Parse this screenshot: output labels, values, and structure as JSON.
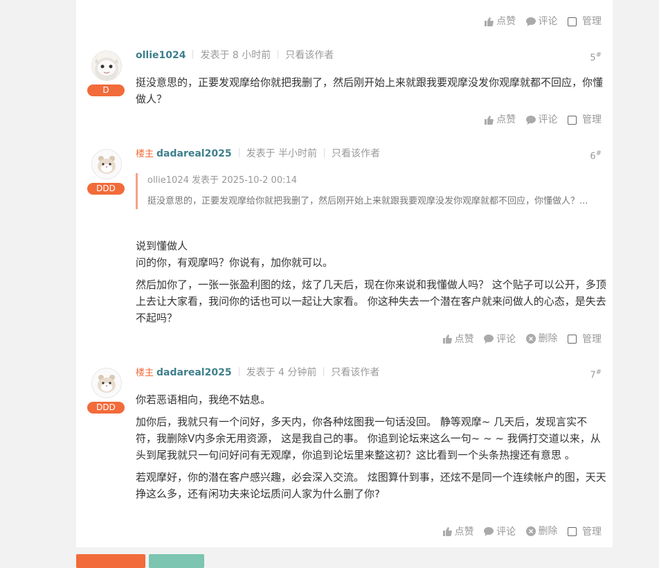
{
  "actions": {
    "like": "点赞",
    "comment": "评论",
    "delete": "删除",
    "manage": "管理"
  },
  "posts": [
    {
      "badge": "D",
      "owner": "",
      "username": "ollie1024",
      "posted": "发表于 8 小时前",
      "only_author": "只看该作者",
      "floor": "5",
      "content": [
        "挺没意思的，正要发观摩给你就把我删了，然后刚开始上来就跟我要观摩没发你观摩就都不回应，你懂做人？"
      ]
    },
    {
      "badge": "DDD",
      "owner": "楼主",
      "username": "dadareal2025",
      "posted": "发表于 半小时前",
      "only_author": "只看该作者",
      "floor": "6",
      "quote": {
        "head": "ollie1024 发表于 2025-10-2 00:14",
        "text": "挺没意思的，正要发观摩给你就把我删了，然后刚开始上来就跟我要观摩没发你观摩就都不回应，你懂做人？..."
      },
      "content": [
        "说到懂做人",
        "问的你，有观摩吗？你说有，加你就可以。",
        "然后加你了，一张一张盈利图的炫，炫了几天后，现在你来说和我懂做人吗？ 这个贴子可以公开，多顶上去让大家看，我问你的话也可以一起让大家看。 你这种失去一个潜在客户就来问做人的心态，是失去不起吗？"
      ]
    },
    {
      "badge": "DDD",
      "owner": "楼主",
      "username": "dadareal2025",
      "posted": "发表于 4 分钟前",
      "only_author": "只看该作者",
      "floor": "7",
      "content": [
        "你若恶语相向，我绝不姑息。",
        "加你后，我就只有一个问好，多天内，你各种炫图我一句话没回。 静等观摩~ 几天后，发现言实不符，我删除V内多余无用资源， 这是我自己的事。 你追到论坛来这么一句~ ~ ~ 我俩打交道以来，从头到尾我就只一句问好问有无观摩，你追到论坛里来整这初？这比看到一个头条热搜还有意思 。",
        "若观摩好，你的潜在客户感兴趣，必会深入交流。 炫图算什到事，还炫不是同一个连续帐户的图，天天挣这么多，还有闲功夫来论坛质问人家为什么删了你?"
      ]
    }
  ],
  "colors": {
    "badge": "#f26b3a",
    "owner": "#f26b3a",
    "username": "#3f7f8c",
    "quote_border": "#f5a08a"
  }
}
